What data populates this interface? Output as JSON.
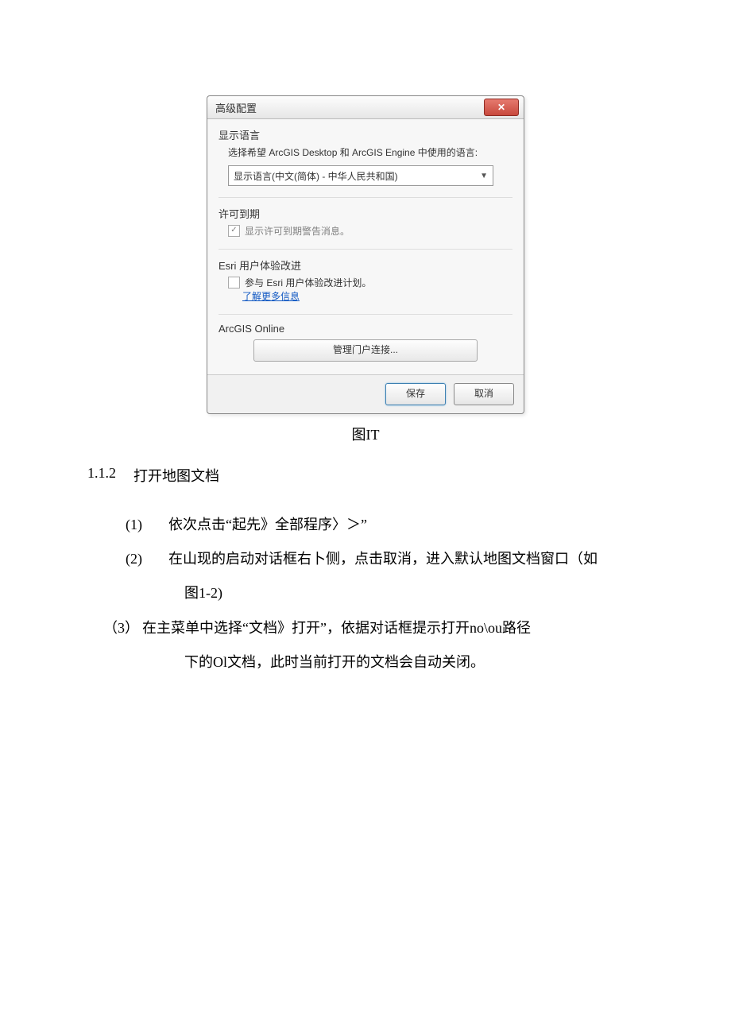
{
  "dialog": {
    "title": "高级配置",
    "sections": {
      "lang": {
        "title": "显示语言",
        "desc": "选择希望 ArcGIS Desktop 和 ArcGIS Engine 中使用的语言:",
        "combo_value": "显示语言(中文(简体) - 中华人民共和国)"
      },
      "license": {
        "title": "许可到期",
        "checkbox_label": "显示许可到期警告消息。",
        "checked": true
      },
      "esri": {
        "title": "Esri 用户体验改进",
        "checkbox_label": "参与 Esri 用户体验改进计划。",
        "link": "了解更多信息"
      },
      "online": {
        "title": "ArcGIS Online",
        "button": "管理门户连接..."
      }
    },
    "footer": {
      "save": "保存",
      "cancel": "取消"
    }
  },
  "caption": "图IT",
  "heading": {
    "number": "1.1.2",
    "text": "打开地图文档"
  },
  "steps": {
    "s1_num": "(1)",
    "s1_text": "依次点击“起先》全部程序〉＞”",
    "s2_num": "(2)",
    "s2_text": "在山现的启动对话框右卜侧，点击取消，进入默认地图文档窗口（如",
    "s2_cont": "图1-2)",
    "s3_num": "（3）",
    "s3_text": "在主菜单中选择“文档》打开”，依据对话框提示打开no\\ou路径",
    "s3_cont": "下的Ol文档，此时当前打开的文档会自动关闭。"
  }
}
